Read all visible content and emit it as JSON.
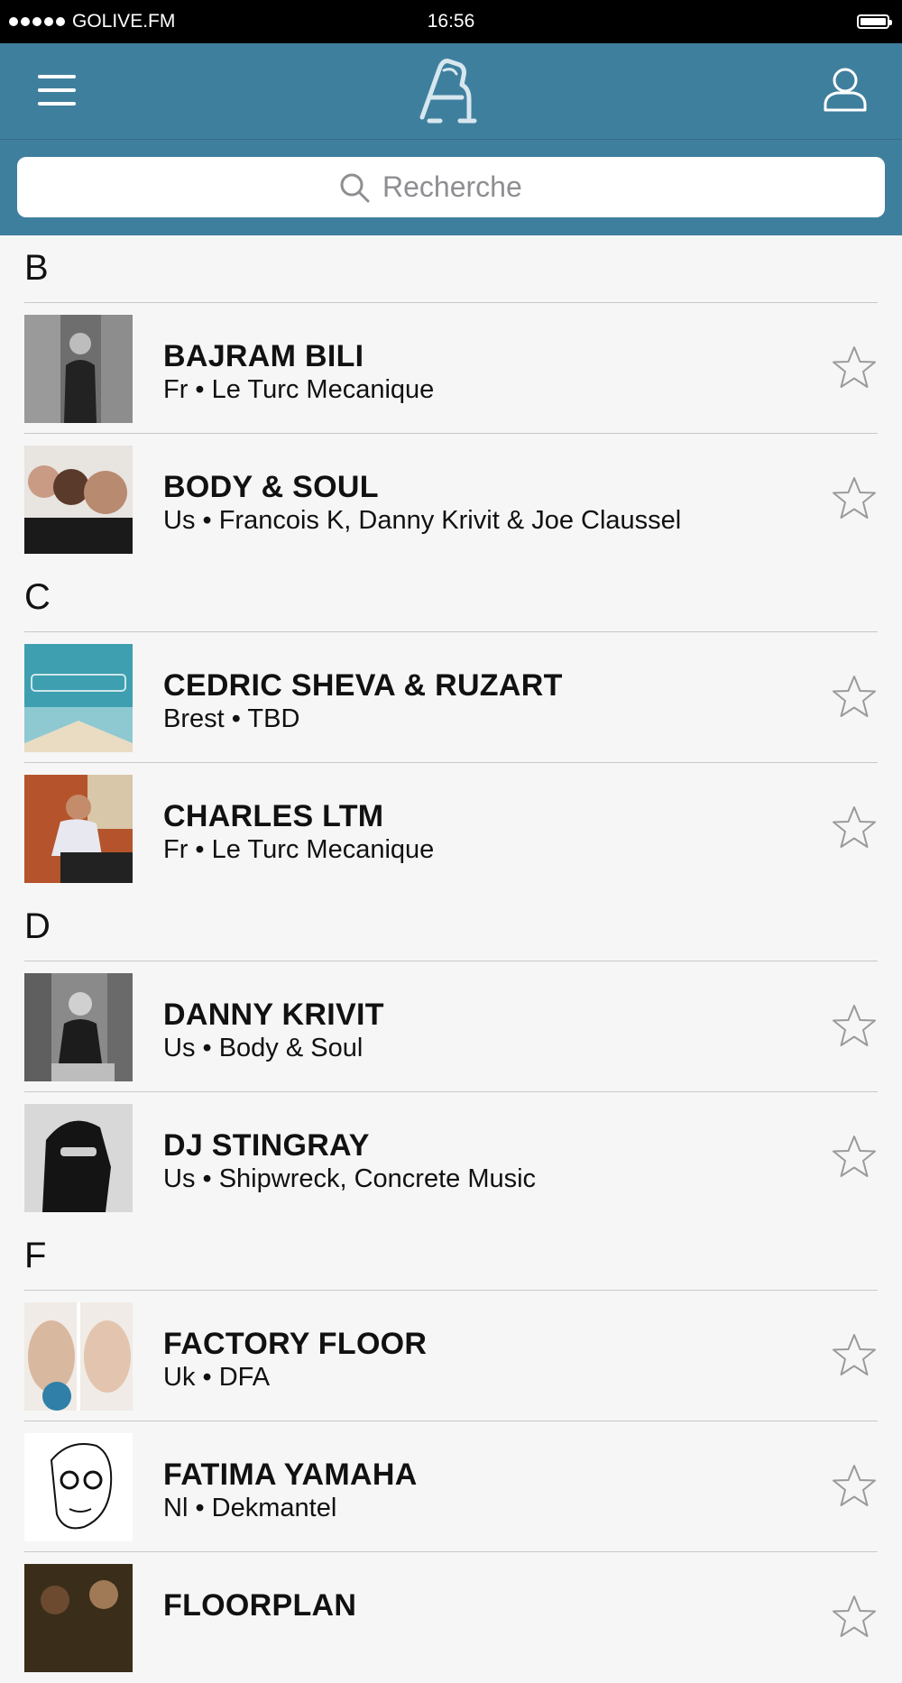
{
  "status_bar": {
    "carrier": "GOLIVE.FM",
    "time": "16:56",
    "battery_icon": "battery-full-icon"
  },
  "navbar": {
    "menu_icon": "hamburger-menu-icon",
    "logo_icon": "app-logo-icon",
    "profile_icon": "user-profile-icon",
    "color": "#3f7f9e"
  },
  "search": {
    "placeholder": "Recherche",
    "icon": "search-icon"
  },
  "sections": [
    {
      "letter": "B",
      "items": [
        {
          "name": "BAJRAM BILI",
          "subtitle": "Fr • Le Turc Mecanique"
        },
        {
          "name": "BODY & SOUL",
          "subtitle": "Us • Francois K, Danny Krivit & Joe Claussel"
        }
      ]
    },
    {
      "letter": "C",
      "items": [
        {
          "name": "CEDRIC SHEVA & RUZART",
          "subtitle": "Brest • TBD"
        },
        {
          "name": "CHARLES LTM",
          "subtitle": "Fr • Le Turc Mecanique"
        }
      ]
    },
    {
      "letter": "D",
      "items": [
        {
          "name": "DANNY KRIVIT",
          "subtitle": "Us • Body & Soul"
        },
        {
          "name": "DJ STINGRAY",
          "subtitle": "Us • Shipwreck, Concrete Music"
        }
      ]
    },
    {
      "letter": "F",
      "items": [
        {
          "name": "FACTORY FLOOR",
          "subtitle": "Uk • DFA"
        },
        {
          "name": "FATIMA YAMAHA",
          "subtitle": "Nl • Dekmantel"
        },
        {
          "name": "FLOORPLAN",
          "subtitle": ""
        }
      ]
    }
  ],
  "favorite_icon": "star-outline-icon"
}
